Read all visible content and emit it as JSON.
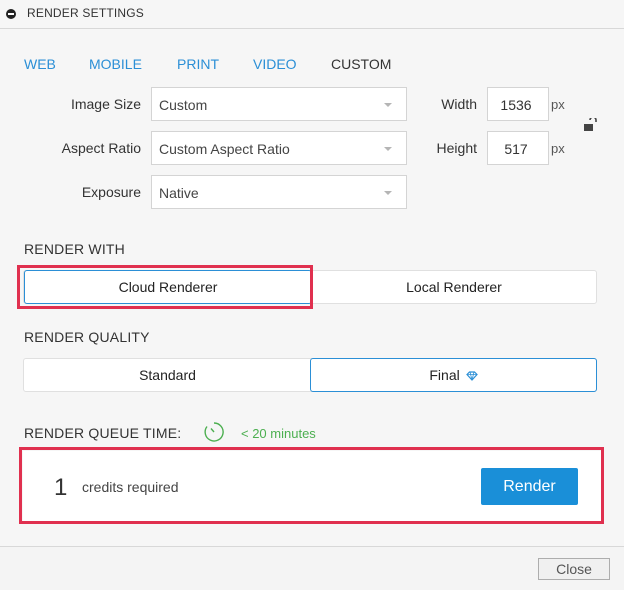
{
  "header": {
    "title": "RENDER SETTINGS"
  },
  "tabs": [
    {
      "label": "WEB",
      "active": false
    },
    {
      "label": "MOBILE",
      "active": false
    },
    {
      "label": "PRINT",
      "active": false
    },
    {
      "label": "VIDEO",
      "active": false
    },
    {
      "label": "CUSTOM",
      "active": true
    }
  ],
  "form": {
    "image_size": {
      "label": "Image Size",
      "value": "Custom"
    },
    "aspect_ratio": {
      "label": "Aspect Ratio",
      "value": "Custom Aspect Ratio"
    },
    "exposure": {
      "label": "Exposure",
      "value": "Native"
    },
    "width": {
      "label": "Width",
      "value": "1536",
      "unit": "px"
    },
    "height": {
      "label": "Height",
      "value": "517",
      "unit": "px"
    }
  },
  "render_with": {
    "title": "RENDER WITH",
    "options": [
      "Cloud Renderer",
      "Local Renderer"
    ],
    "selected": "Cloud Renderer"
  },
  "render_quality": {
    "title": "RENDER QUALITY",
    "options": [
      "Standard",
      "Final"
    ],
    "selected": "Final"
  },
  "queue": {
    "title": "RENDER QUEUE TIME:",
    "value": "< 20 minutes"
  },
  "credits": {
    "count": "1",
    "text": "credits required",
    "render_label": "Render"
  },
  "footer": {
    "close_label": "Close"
  },
  "colors": {
    "accent": "#1a8fd8",
    "link": "#2b8fd6",
    "highlight": "#e0304f",
    "queue_green": "#4caf50"
  },
  "icons": {
    "header": "minus-circle-icon",
    "lock": "unlocked-padlock-icon",
    "final": "diamond-icon",
    "queue": "timer-icon",
    "dropdown": "caret-down-icon"
  }
}
